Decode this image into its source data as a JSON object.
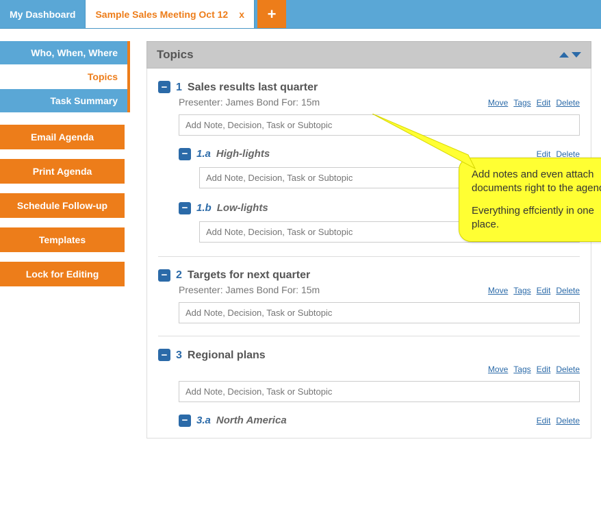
{
  "tabs": {
    "dashboard": "My Dashboard",
    "active": "Sample Sales Meeting Oct 12",
    "close": "x"
  },
  "sidenav": {
    "who": "Who, When, Where",
    "topics": "Topics",
    "tasks": "Task Summary"
  },
  "sidebuttons": {
    "email": "Email Agenda",
    "print": "Print Agenda",
    "schedule": "Schedule Follow-up",
    "templates": "Templates",
    "lock": "Lock for Editing"
  },
  "panel": {
    "title": "Topics"
  },
  "actions": {
    "move": "Move",
    "tags": "Tags",
    "edit": "Edit",
    "delete": "Delete"
  },
  "placeholder": "Add Note, Decision, Task or Subtopic",
  "topics": [
    {
      "num": "1",
      "title": "Sales results last quarter",
      "meta": "Presenter: James Bond For: 15m",
      "subs": [
        {
          "num": "1.a",
          "title": "High-lights"
        },
        {
          "num": "1.b",
          "title": "Low-lights"
        }
      ]
    },
    {
      "num": "2",
      "title": "Targets for next quarter",
      "meta": "Presenter: James Bond For: 15m",
      "subs": []
    },
    {
      "num": "3",
      "title": "Regional plans",
      "meta": "",
      "subs": [
        {
          "num": "3.a",
          "title": "North America"
        }
      ]
    }
  ],
  "callout": {
    "p1": "Add notes and even attach documents right to the agenda.",
    "p2": "Everything effciently in one place."
  }
}
